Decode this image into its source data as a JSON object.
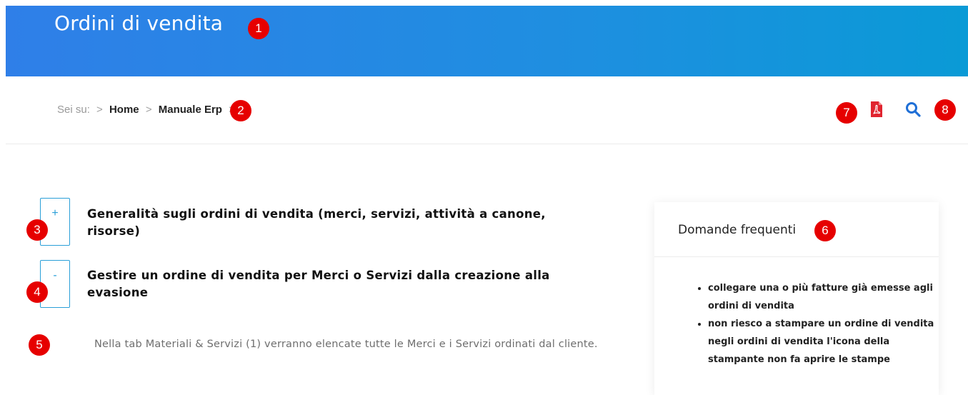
{
  "header": {
    "title": "Ordini di vendita"
  },
  "breadcrumb": {
    "prefix": "Sei su:",
    "separator": ">",
    "items": [
      "Home",
      "Manuale Erp"
    ]
  },
  "toolbar": {
    "pdf_icon": "pdf-icon",
    "search_icon": "search-icon"
  },
  "accordion": [
    {
      "toggle": "+",
      "title": "Generalità sugli ordini di vendita (merci, servizi, attività a canone, risorse)"
    },
    {
      "toggle": "-",
      "title": "Gestire un ordine di vendita per Merci o Servizi dalla creazione alla evasione"
    }
  ],
  "content": {
    "paragraph": "Nella tab Materiali & Servizi (1) verranno elencate tutte le Merci e i Servizi ordinati dal cliente."
  },
  "faq": {
    "title": "Domande frequenti",
    "items": [
      "collegare una o più fatture già emesse agli ordini di vendita",
      "non riesco a stampare un ordine di vendita negli ordini di vendita l'icona della stampante non fa aprire le stampe"
    ]
  },
  "annotations": [
    "1",
    "2",
    "3",
    "4",
    "5",
    "6",
    "7",
    "8"
  ],
  "colors": {
    "header_start": "#2f7fe8",
    "header_end": "#0a9ad6",
    "accent": "#1f6fd6",
    "pdf": "#e0242f",
    "badge": "#e60000"
  }
}
